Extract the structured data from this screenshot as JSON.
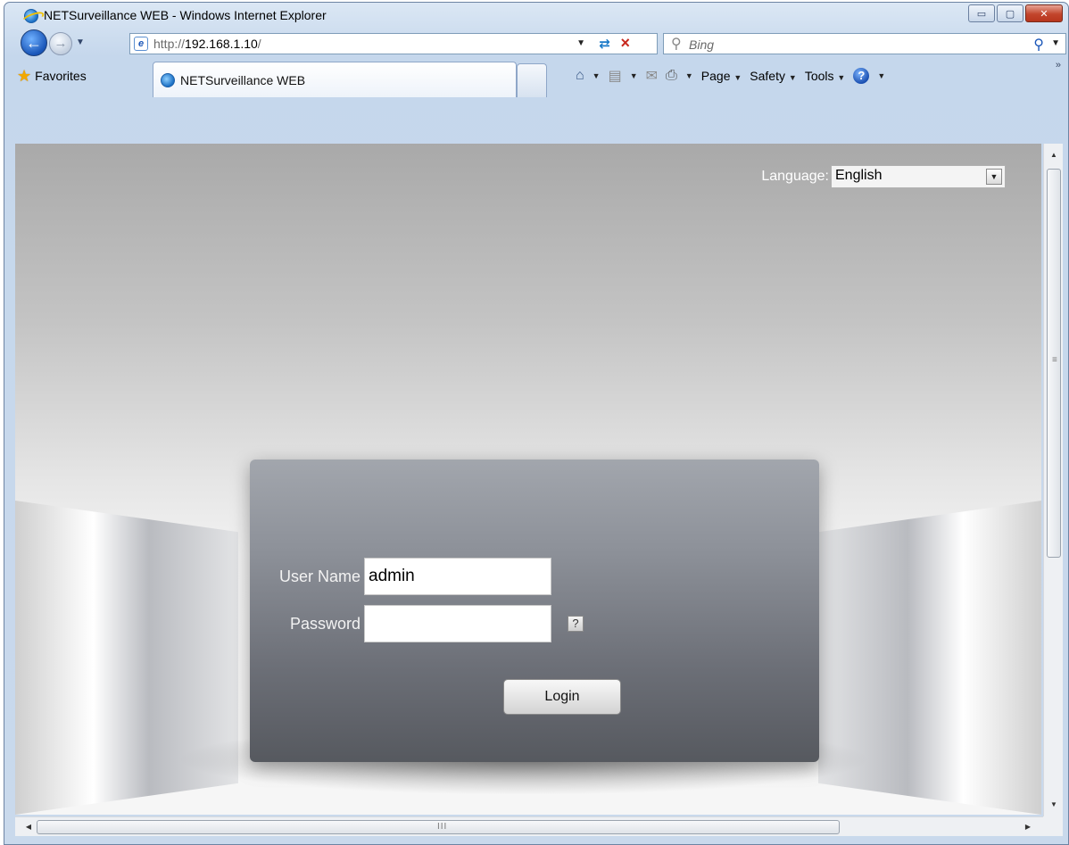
{
  "window": {
    "title": "NETSurveillance WEB - Windows Internet Explorer",
    "minimize_glyph": "▭",
    "maximize_glyph": "▢",
    "close_glyph": "✕"
  },
  "addressbar": {
    "url_prefix": "http://",
    "url_host": "192.168.1.10",
    "url_suffix": "/",
    "search_placeholder": "Bing"
  },
  "favorites_bar": {
    "favorites_label": "Favorites",
    "tab_title": "NETSurveillance WEB"
  },
  "command_bar": {
    "page_label": "Page",
    "safety_label": "Safety",
    "tools_label": "Tools",
    "help_glyph": "?"
  },
  "page": {
    "language_label": "Language:",
    "language_selected": "English",
    "username_label": "User Name",
    "username_value": "admin",
    "password_label": "Password",
    "password_value": "",
    "password_help": "?",
    "login_label": "Login"
  },
  "scrollbar": {
    "h_grip": "III",
    "v_grip": "≡"
  },
  "icons": [
    "ie-logo-icon",
    "back-arrow-icon",
    "forward-arrow-icon",
    "page-icon",
    "refresh-icon",
    "stop-icon",
    "search-icon",
    "star-icon",
    "home-icon",
    "rss-icon",
    "mail-icon",
    "print-icon",
    "help-icon"
  ]
}
